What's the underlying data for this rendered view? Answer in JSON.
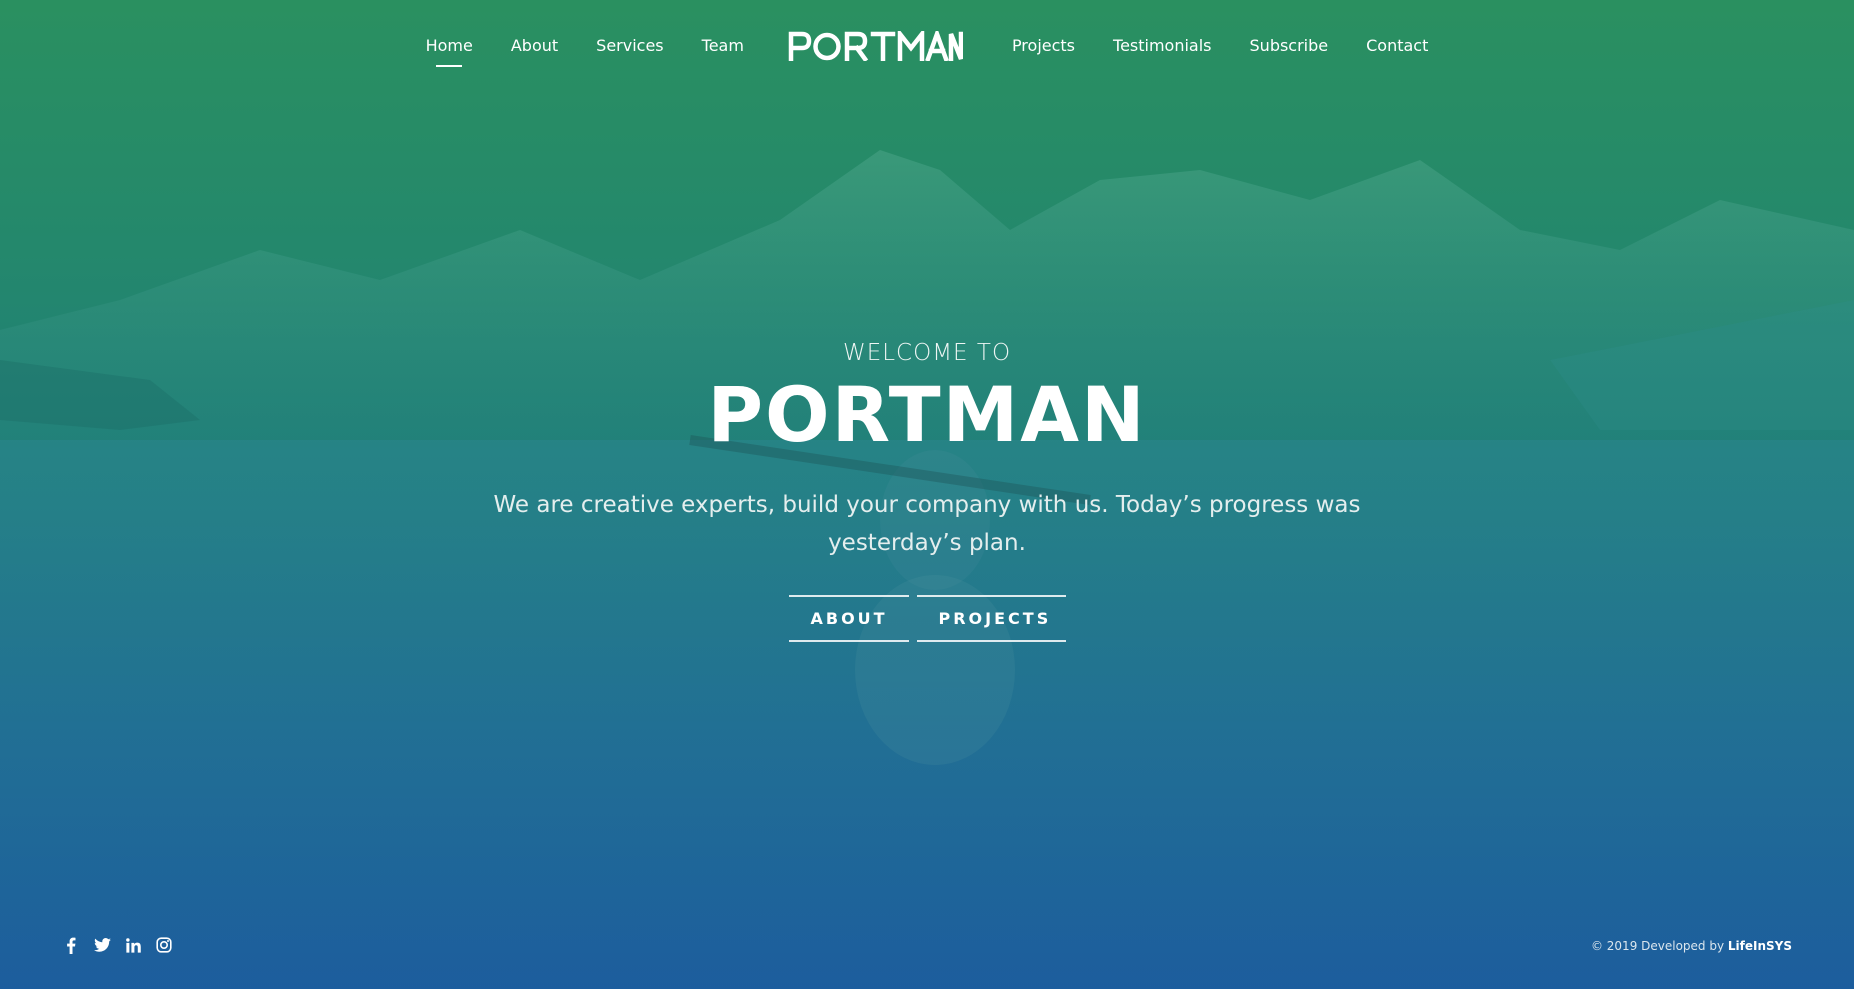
{
  "nav": {
    "left_items": [
      {
        "label": "Home",
        "active": true
      },
      {
        "label": "About"
      },
      {
        "label": "Services"
      },
      {
        "label": "Team"
      }
    ],
    "logo_text": "PORTMAN",
    "right_items": [
      {
        "label": "Projects"
      },
      {
        "label": "Testimonials"
      },
      {
        "label": "Subscribe"
      },
      {
        "label": "Contact"
      }
    ]
  },
  "hero": {
    "welcome": "WELCOME TO",
    "title": "PORTMAN",
    "tagline": "We are creative experts, build your company with us. Today’s progress was yesterday’s plan.",
    "buttons": {
      "about": "ABOUT",
      "projects": "PROJECTS"
    }
  },
  "footer": {
    "social_icons": [
      "facebook-icon",
      "twitter-icon",
      "linkedin-icon",
      "instagram-icon"
    ],
    "copyright_prefix": "© 2019 Developed by ",
    "developer": "LifeInSYS"
  },
  "colors": {
    "gradient_top": "#2a9060",
    "gradient_bottom": "#1a5a9a",
    "text": "#ffffff"
  }
}
